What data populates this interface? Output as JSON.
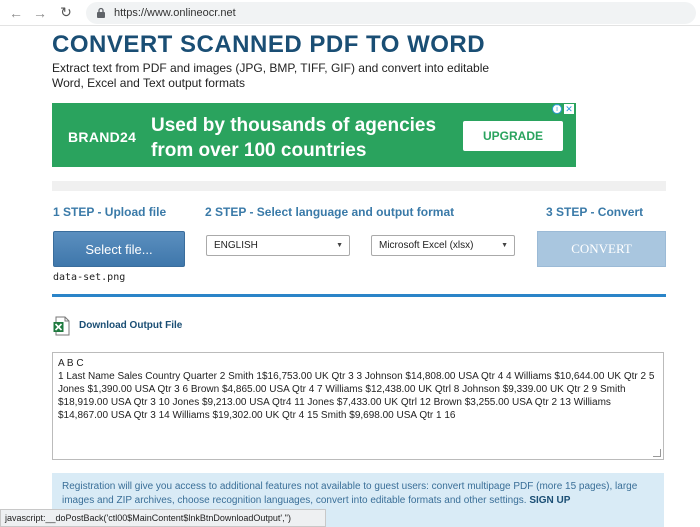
{
  "browser": {
    "url": "https://www.onlineocr.net"
  },
  "page": {
    "title": "CONVERT SCANNED PDF TO WORD",
    "subtitle": "Extract text from PDF and images (JPG, BMP, TIFF, GIF) and convert into editable Word, Excel and Text output formats"
  },
  "ad": {
    "brand": "BRAND24",
    "text_line1": "Used by thousands of agencies",
    "text_line2": "from over 100 countries",
    "button": "UPGRADE",
    "info_icon": "i",
    "close_icon": "✕"
  },
  "steps": {
    "step1": "1 STEP - Upload file",
    "step2": "2 STEP - Select language and output format",
    "step3": "3 STEP - Convert"
  },
  "upload": {
    "button": "Select file...",
    "file_name": "data-set.png"
  },
  "language": {
    "selected": "ENGLISH"
  },
  "output_format": {
    "selected": "Microsoft Excel (xlsx)"
  },
  "convert": {
    "button": "CONVERT"
  },
  "download": {
    "label": "Download Output File"
  },
  "output_text": {
    "line1": "A B C",
    "line2": "1 Last Name Sales Country Quarter 2 Smith 1$16,753.00 UK Qtr 3 3 Johnson $14,808.00 USA Qtr 4 4 Williams $10,644.00 UK Qtr 2 5 Jones $1,390.00 USA Qtr 3 6 Brown $4,865.00 USA Qtr 4 7 Williams $12,438.00 UK Qtrl 8 Johnson $9,339.00 UK Qtr 2 9 Smith $18,919.00 USA Qtr 3 10 Jones $9,213.00 USA Qtr4 11 Jones $7,433.00 UK Qtrl 12 Brown $3,255.00 USA Qtr 2 13 Williams $14,867.00 USA Qtr 3 14 Williams $19,302.00 UK Qtr 4 15 Smith $9,698.00 USA Qtr 1 16"
  },
  "notice": {
    "text": "Registration will give you access to additional features not available to guest users: convert multipage PDF (more 15 pages), large images and ZIP archives, choose recognition languages, convert into editable formats and other settings.",
    "signup": "SIGN UP"
  },
  "status_bar": {
    "text": "javascript:__doPostBack('ctl00$MainContent$lnkBtnDownloadOutput','')"
  },
  "colors": {
    "title": "#1a4e74",
    "ad_bg": "#2aa35e",
    "step": "#3a7aa8",
    "divider": "#2a84c8",
    "convert_disabled": "#a9c6df"
  }
}
